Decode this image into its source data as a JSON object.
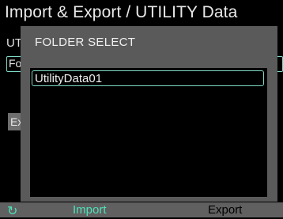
{
  "header": {
    "title": "Import & Export / UTILITY Data"
  },
  "background": {
    "section_label_fragment": "UT",
    "field_fragment": "Fo",
    "export_fragment": "Ex"
  },
  "dialog": {
    "title": "FOLDER SELECT",
    "items": [
      {
        "label": "UtilityData01",
        "selected": true
      }
    ]
  },
  "footer": {
    "refresh_icon": "↻",
    "import_label": "Import",
    "export_label": "Export"
  },
  "colors": {
    "accent": "#4fe0b8",
    "dialog_bg": "#5a5a5a",
    "bottom_bar": "#606060"
  }
}
